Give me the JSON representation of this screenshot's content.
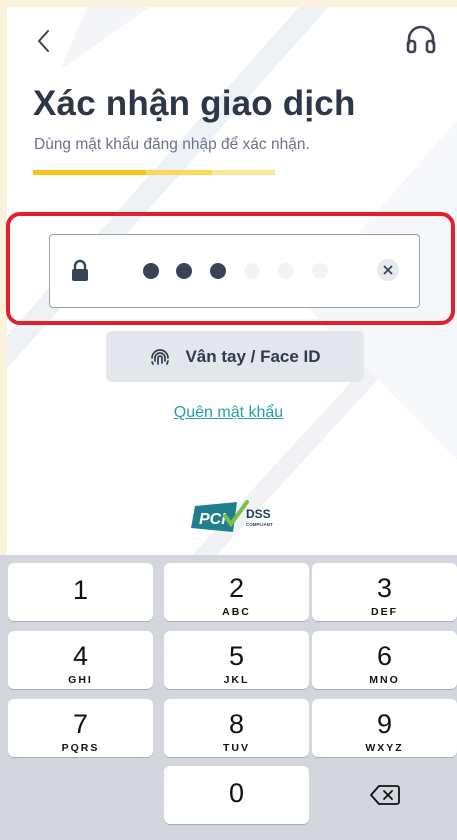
{
  "header": {
    "back_icon": "chevron-left-icon",
    "support_icon": "headset-icon"
  },
  "page": {
    "title": "Xác nhận giao dịch",
    "subtitle": "Dùng mật khẩu đăng nhập để xác nhận.",
    "step_progress": {
      "completed_segments": 1,
      "total_segments": 3
    }
  },
  "colors": {
    "accent_yellow": "#f5c518",
    "accent_yellow_light": "#fbe79a",
    "highlight_red": "#e1202c",
    "link_teal": "#25a0a8",
    "title_text": "#2d3748"
  },
  "pin": {
    "filled_count": 3,
    "total_count": 6,
    "lock_icon": "lock-icon",
    "clear_icon": "clear-x-icon"
  },
  "biometric": {
    "label": "Vân tay / Face ID",
    "icon": "fingerprint-icon"
  },
  "forgot_password": "Quên mật khẩu",
  "pci": {
    "text_main": "PCI",
    "text_dss": "DSS",
    "text_compliant": "COMPLIANT"
  },
  "keypad": {
    "keys": [
      {
        "digit": "1",
        "letters": ""
      },
      {
        "digit": "2",
        "letters": "ABC"
      },
      {
        "digit": "3",
        "letters": "DEF"
      },
      {
        "digit": "4",
        "letters": "GHI"
      },
      {
        "digit": "5",
        "letters": "JKL"
      },
      {
        "digit": "6",
        "letters": "MNO"
      },
      {
        "digit": "7",
        "letters": "PQRS"
      },
      {
        "digit": "8",
        "letters": "TUV"
      },
      {
        "digit": "9",
        "letters": "WXYZ"
      },
      {
        "digit": "0",
        "letters": ""
      }
    ],
    "backspace_icon": "backspace-icon"
  }
}
